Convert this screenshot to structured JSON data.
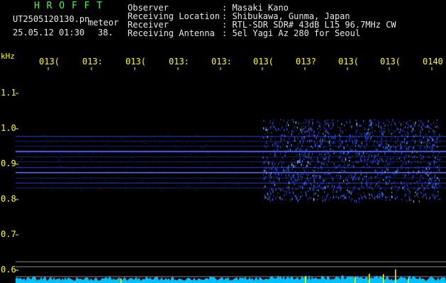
{
  "header": {
    "brand": "H R O F F T",
    "filename": "UT2505120130.pn",
    "tag": "meteor",
    "datetime": "25.05.12 01:30",
    "count": "38.",
    "info": [
      {
        "label": "Observer",
        "value": ": Masaki Kano"
      },
      {
        "label": "Receiving Location",
        "value": ": Shibukawa, Gunma, Japan"
      },
      {
        "label": "Receiver",
        "value": ": RTL-SDR SDR# 43dB L15 96.7MHz CW"
      },
      {
        "label": "Receiving Antenna",
        "value": ": 5el Yagi Az 280 for Seoul"
      }
    ]
  },
  "axes": {
    "y_unit": "kHz",
    "y_ticks": [
      "1.1",
      "1.0",
      "0.9",
      "0.8",
      "0.7",
      "0.6"
    ],
    "x_ticks": [
      "013(",
      "013:",
      "013(",
      "013:",
      "013:",
      "013(",
      "013?",
      "013(",
      "013(",
      "0140"
    ]
  },
  "colors": {
    "background": "#000000",
    "brand": "#3cff3c",
    "text": "#e8e8e8",
    "tick": "#ffff00",
    "signal": "#2a4cff",
    "highlight": "#7fd8ff",
    "floor": "#00bfff"
  }
}
